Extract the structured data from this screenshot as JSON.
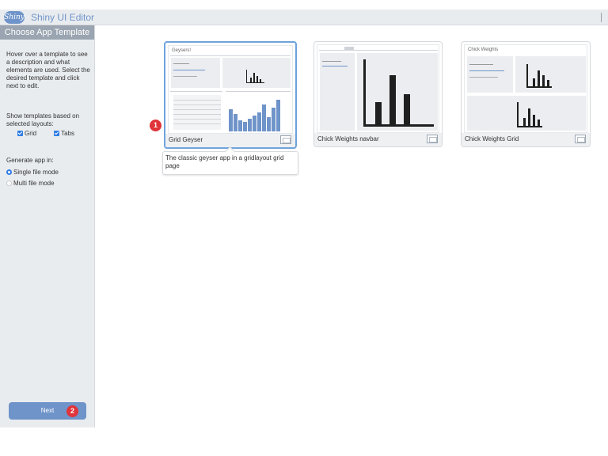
{
  "header": {
    "logo_text": "Shiny",
    "title": "Shiny UI Editor"
  },
  "sidebar": {
    "title": "Choose App Template",
    "instructions": "Hover over a template to see a description and what elements are used. Select the desired template and click next to edit.",
    "show_label": "Show templates based on selected layouts:",
    "layout_options": [
      {
        "label": "Grid",
        "checked": true
      },
      {
        "label": "Tabs",
        "checked": true
      }
    ],
    "generate_label": "Generate app in:",
    "mode_options": [
      {
        "label": "Single file mode",
        "selected": true
      },
      {
        "label": "Multi file mode",
        "selected": false
      }
    ],
    "next_label": "Next",
    "next_badge": "2"
  },
  "templates": [
    {
      "name": "Grid Geyser",
      "selected": true,
      "thumb_title": "Geysers!",
      "description": "The classic geyser app in a gridlayout grid page",
      "badge": "1"
    },
    {
      "name": "Chick Weights navbar",
      "selected": false,
      "thumb_title": ""
    },
    {
      "name": "Chick Weights Grid",
      "selected": false,
      "thumb_title": "Chick Weights"
    }
  ],
  "colors": {
    "accent": "#6f94c9",
    "badge": "#e0343a",
    "checkbox": "#2c7be5",
    "sidebar_bg": "#e9ecef"
  }
}
